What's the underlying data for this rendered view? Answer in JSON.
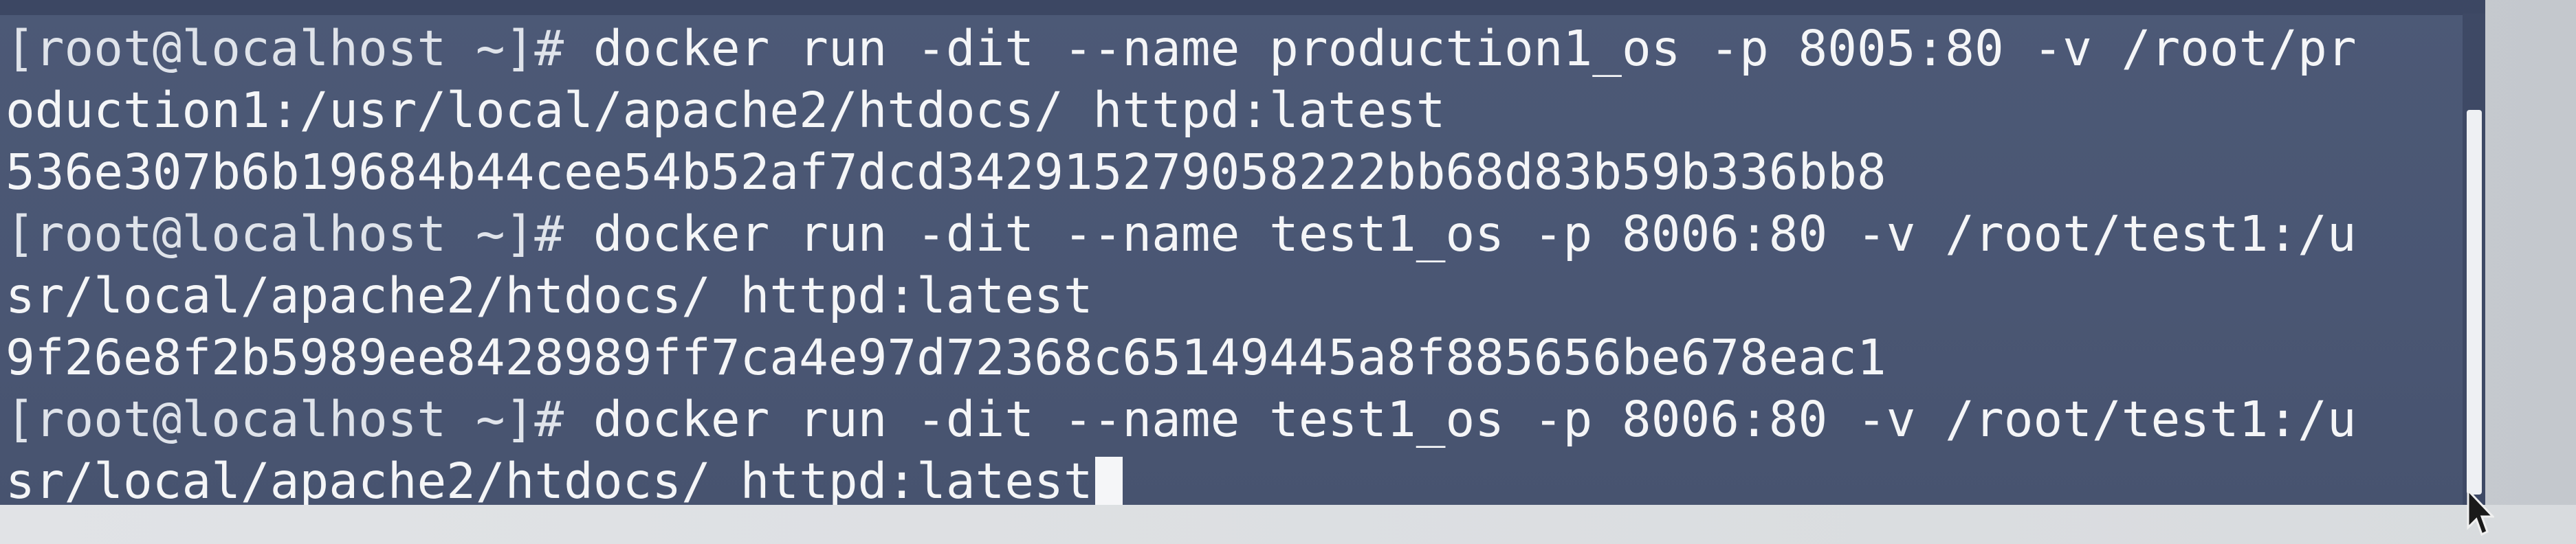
{
  "terminal": {
    "lines": [
      {
        "prompt": "[root@localhost ~]# ",
        "text": "docker run -dit --name production1_os -p 8005:80 -v /root/pr"
      },
      {
        "prompt": "",
        "text": "oduction1:/usr/local/apache2/htdocs/ httpd:latest"
      },
      {
        "prompt": "",
        "text": "536e307b6b19684b44cee54b52af7dcd342915279058222bb68d83b59b336bb8"
      },
      {
        "prompt": "[root@localhost ~]# ",
        "text": "docker run -dit --name test1_os -p 8006:80 -v /root/test1:/u"
      },
      {
        "prompt": "",
        "text": "sr/local/apache2/htdocs/ httpd:latest"
      },
      {
        "prompt": "",
        "text": "9f26e8f2b5989ee8428989ff7ca4e97d72368c65149445a8f885656be678eac1"
      },
      {
        "prompt": "[root@localhost ~]# ",
        "text": "docker run -dit --name test1_os -p 8006:80 -v /root/test1:/u"
      },
      {
        "prompt": "",
        "text": "sr/local/apache2/htdocs/ httpd:latest"
      }
    ]
  },
  "icons": {
    "cursor": "text-cursor-block",
    "pointer": "mouse-arrow-icon"
  },
  "colors": {
    "terminal_bg": "#4b5774",
    "text": "#f4f5f7"
  }
}
